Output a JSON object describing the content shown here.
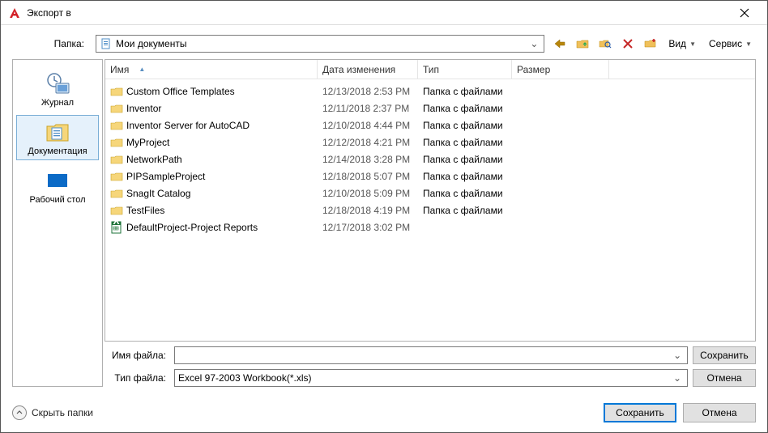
{
  "window": {
    "title": "Экспорт в"
  },
  "folder": {
    "label": "Папка:",
    "current": "Мои документы"
  },
  "toolbar": {
    "view": "Вид",
    "service": "Сервис"
  },
  "sidebar": {
    "items": [
      {
        "label": "Журнал"
      },
      {
        "label": "Документация"
      },
      {
        "label": "Рабочий стол"
      }
    ]
  },
  "columns": {
    "name": "Имя",
    "date": "Дата изменения",
    "type": "Тип",
    "size": "Размер"
  },
  "files": [
    {
      "icon": "folder",
      "name": "Custom Office Templates",
      "date": "12/13/2018 2:53 PM",
      "type": "Папка с файлами",
      "size": ""
    },
    {
      "icon": "folder",
      "name": "Inventor",
      "date": "12/11/2018 2:37 PM",
      "type": "Папка с файлами",
      "size": ""
    },
    {
      "icon": "folder",
      "name": "Inventor Server for AutoCAD",
      "date": "12/10/2018 4:44 PM",
      "type": "Папка с файлами",
      "size": ""
    },
    {
      "icon": "folder",
      "name": "MyProject",
      "date": "12/12/2018 4:21 PM",
      "type": "Папка с файлами",
      "size": ""
    },
    {
      "icon": "folder",
      "name": "NetworkPath",
      "date": "12/14/2018 3:28 PM",
      "type": "Папка с файлами",
      "size": ""
    },
    {
      "icon": "folder",
      "name": "PIPSampleProject",
      "date": "12/18/2018 5:07 PM",
      "type": "Папка с файлами",
      "size": ""
    },
    {
      "icon": "folder",
      "name": "SnagIt Catalog",
      "date": "12/10/2018 5:09 PM",
      "type": "Папка с файлами",
      "size": ""
    },
    {
      "icon": "folder",
      "name": "TestFiles",
      "date": "12/18/2018 4:19 PM",
      "type": "Папка с файлами",
      "size": ""
    },
    {
      "icon": "xls",
      "name": "DefaultProject-Project Reports",
      "date": "12/17/2018 3:02 PM",
      "type": "",
      "size": ""
    }
  ],
  "form": {
    "filename_label": "Имя файла:",
    "filename_value": "",
    "filetype_label": "Тип файла:",
    "filetype_value": "Excel 97-2003 Workbook(*.xls)",
    "save_btn": "Сохранить",
    "cancel_btn": "Отмена"
  },
  "bottom": {
    "hide_folders": "Скрыть папки",
    "save": "Сохранить",
    "cancel": "Отмена"
  }
}
